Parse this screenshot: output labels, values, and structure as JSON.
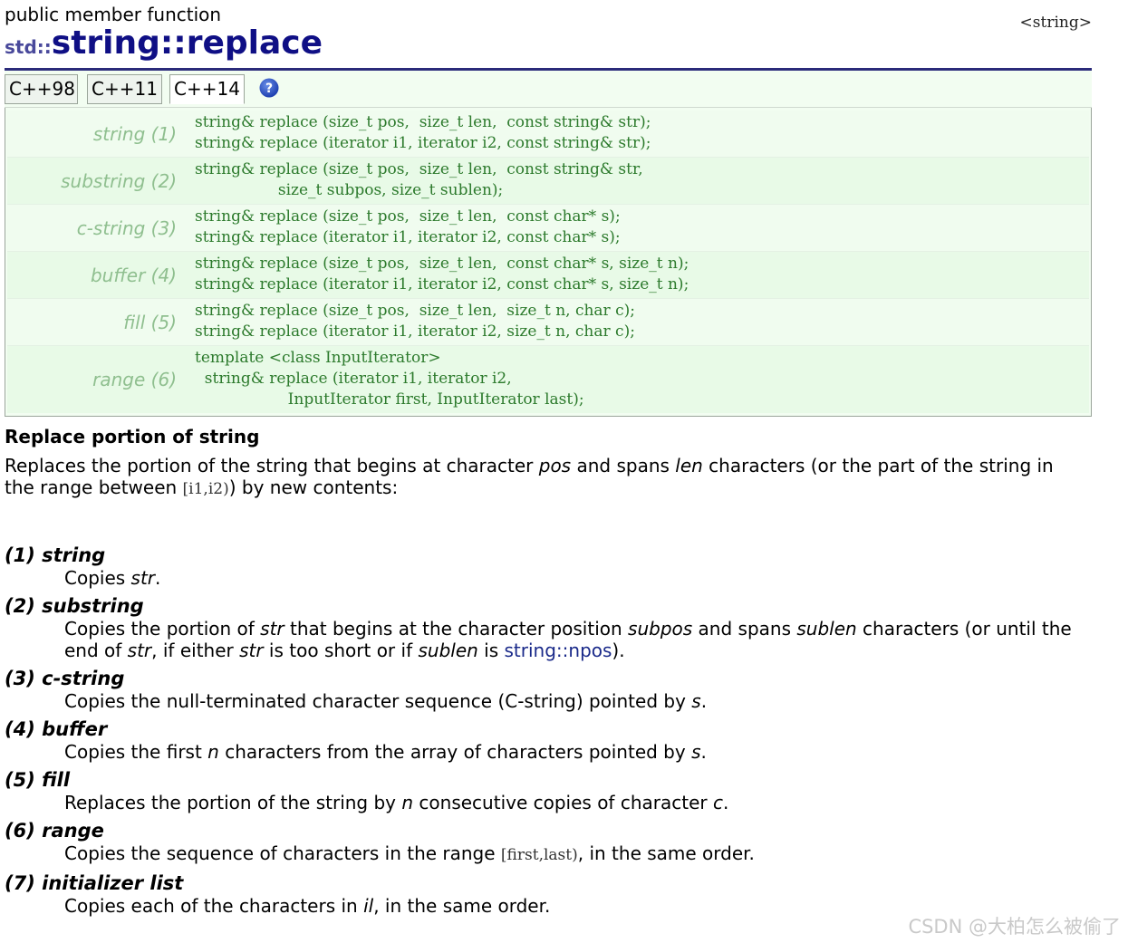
{
  "header": {
    "kind": "public member function",
    "namespace": "std::",
    "name": "string::replace",
    "tag": "<string>"
  },
  "tabs": [
    {
      "label": "C++98"
    },
    {
      "label": "C++11"
    },
    {
      "label": "C++14"
    }
  ],
  "help_icon": "question-circle-icon",
  "prototypes": [
    {
      "label": "string (1)",
      "code": "string& replace (size_t pos,  size_t len,  const string& str);\nstring& replace (iterator i1, iterator i2, const string& str);"
    },
    {
      "label": "substring (2)",
      "code": "string& replace (size_t pos,  size_t len,  const string& str,\n                 size_t subpos, size_t sublen);"
    },
    {
      "label": "c-string (3)",
      "code": "string& replace (size_t pos,  size_t len,  const char* s);\nstring& replace (iterator i1, iterator i2, const char* s);"
    },
    {
      "label": "buffer (4)",
      "code": "string& replace (size_t pos,  size_t len,  const char* s, size_t n);\nstring& replace (iterator i1, iterator i2, const char* s, size_t n);"
    },
    {
      "label": "fill (5)",
      "code": "string& replace (size_t pos,  size_t len,  size_t n, char c);\nstring& replace (iterator i1, iterator i2, size_t n, char c);"
    },
    {
      "label": "range (6)",
      "code": "template <class InputIterator>\n  string& replace (iterator i1, iterator i2,\n                   InputIterator first, InputIterator last);"
    }
  ],
  "summary": {
    "title": "Replace portion of string",
    "p1": "Replaces the portion of the string that begins at character ",
    "p1_pos": "pos",
    "p1_b": " and spans ",
    "p1_len": "len",
    "p1_c": " characters (or the part of the string in the range between ",
    "p1_range": "[i1,i2)",
    "p1_d": ") by new contents:"
  },
  "params": [
    {
      "term": "(1) string",
      "desc": [
        {
          "t": "Copies "
        },
        {
          "i": "str"
        },
        {
          "t": "."
        }
      ]
    },
    {
      "term": "(2) substring",
      "desc": [
        {
          "t": "Copies the portion of "
        },
        {
          "i": "str"
        },
        {
          "t": " that begins at the character position "
        },
        {
          "i": "subpos"
        },
        {
          "t": " and spans "
        },
        {
          "i": "sublen"
        },
        {
          "t": " characters (or until the end of "
        },
        {
          "i": "str"
        },
        {
          "t": ", if either "
        },
        {
          "i": "str"
        },
        {
          "t": " is too short or if "
        },
        {
          "i": "sublen"
        },
        {
          "t": " is "
        },
        {
          "link": "string::npos"
        },
        {
          "t": ")."
        }
      ]
    },
    {
      "term": "(3) c-string",
      "desc": [
        {
          "t": "Copies the null-terminated character sequence (C-string) pointed by "
        },
        {
          "i": "s"
        },
        {
          "t": "."
        }
      ]
    },
    {
      "term": "(4) buffer",
      "desc": [
        {
          "t": "Copies the first "
        },
        {
          "i": "n"
        },
        {
          "t": " characters from the array of characters pointed by "
        },
        {
          "i": "s"
        },
        {
          "t": "."
        }
      ]
    },
    {
      "term": "(5) fill",
      "desc": [
        {
          "t": "Replaces the portion of the string by "
        },
        {
          "i": "n"
        },
        {
          "t": " consecutive copies of character "
        },
        {
          "i": "c"
        },
        {
          "t": "."
        }
      ]
    },
    {
      "term": "(6) range",
      "desc": [
        {
          "t": "Copies the sequence of characters in the range "
        },
        {
          "m": "[first,last)"
        },
        {
          "t": ", in the same order."
        }
      ]
    },
    {
      "term": "(7) initializer list",
      "desc": [
        {
          "t": "Copies each of the characters in "
        },
        {
          "i": "il"
        },
        {
          "t": ", in the same order."
        }
      ]
    }
  ],
  "watermark": "CSDN @大柏怎么被偷了",
  "colors": {
    "title": "#0f0f85",
    "proto_bg": "#f2fdf1",
    "proto_code": "#2c7a2c",
    "proto_label": "#8fbf8f",
    "link": "#1a2a8a"
  }
}
